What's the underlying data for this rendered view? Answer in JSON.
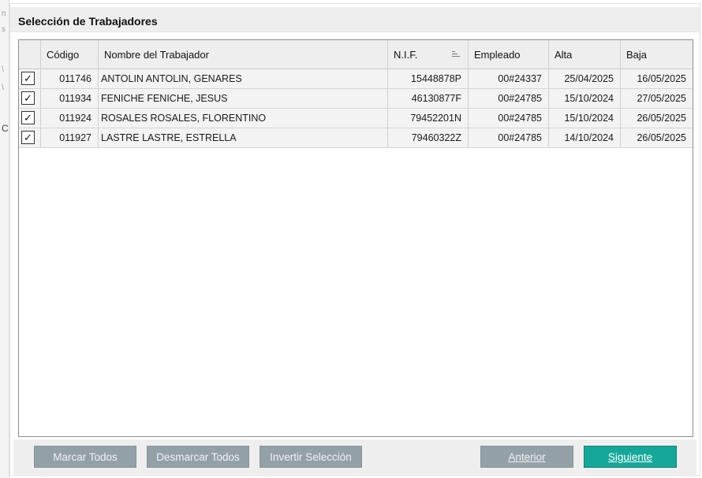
{
  "dialog": {
    "title": "Selección de Trabajadores"
  },
  "edge_glyphs": [
    "n",
    "s",
    "\\",
    "\\",
    "C"
  ],
  "table": {
    "columns": [
      "",
      "Código",
      "Nombre del Trabajador",
      "N.I.F.",
      "Empleado",
      "Alta",
      "Baja"
    ],
    "rows": [
      {
        "checked": "✓",
        "codigo": "011746",
        "nombre": "ANTOLIN ANTOLIN, GENARES",
        "nif": "15448878P",
        "empleado": "00#24337",
        "alta": "25/04/2025",
        "baja": "16/05/2025"
      },
      {
        "checked": "✓",
        "codigo": "011934",
        "nombre": "FENICHE FENICHE, JESUS",
        "nif": "46130877F",
        "empleado": "00#24785",
        "alta": "15/10/2024",
        "baja": "27/05/2025"
      },
      {
        "checked": "✓",
        "codigo": "011924",
        "nombre": "ROSALES ROSALES, FLORENTINO",
        "nif": "79452201N",
        "empleado": "00#24785",
        "alta": "15/10/2024",
        "baja": "26/05/2025"
      },
      {
        "checked": "✓",
        "codigo": "011927",
        "nombre": "LASTRE LASTRE, ESTRELLA",
        "nif": "79460322Z",
        "empleado": "00#24785",
        "alta": "14/10/2024",
        "baja": "26/05/2025"
      }
    ]
  },
  "buttons": {
    "mark_all": "Marcar Todos",
    "unmark_all": "Desmarcar Todos",
    "invert": "Invertir Selección",
    "prev": "Anterior",
    "next": "Siguiente"
  },
  "colors": {
    "accent": "#15a89a",
    "button_gray": "#93a1a7",
    "header_bg": "#eeeeee",
    "row_bg": "#f3f3f3"
  }
}
